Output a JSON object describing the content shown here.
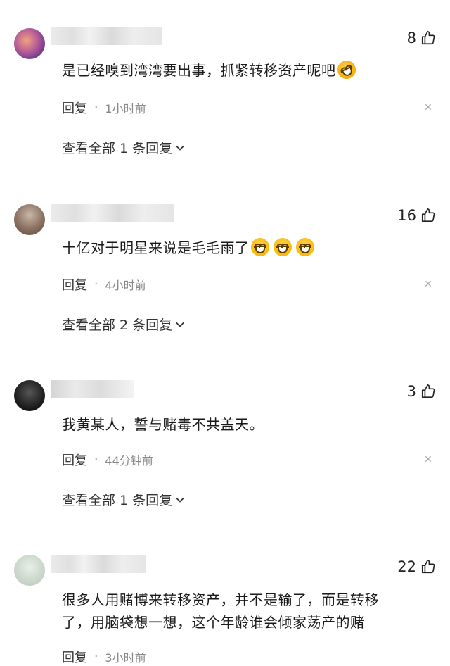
{
  "icons": {
    "like": "thumbs-up-icon",
    "close": "close-icon",
    "expand": "chevron-down-icon"
  },
  "comments": [
    {
      "likes": "8",
      "text": "是已经嗅到湾湾要出事，抓紧转移资产呢吧",
      "reply_label": "回复",
      "separator": "·",
      "time": "1小时前",
      "view_replies": "查看全部 1 条回复",
      "emoji": [
        "rofl-emoji"
      ]
    },
    {
      "likes": "16",
      "text": "十亿对于明星来说是毛毛雨了",
      "reply_label": "回复",
      "separator": "·",
      "time": "4小时前",
      "view_replies": "查看全部 2 条回复",
      "emoji": [
        "grin-emoji",
        "grin-emoji",
        "grin-emoji"
      ]
    },
    {
      "likes": "3",
      "text": "我黄某人，誓与赌毒不共盖天。",
      "reply_label": "回复",
      "separator": "·",
      "time": "44分钟前",
      "view_replies": "查看全部 1 条回复"
    },
    {
      "likes": "22",
      "text_line1": "很多人用赌博来转移资产，并不是输了，而是转移",
      "text_line2": "了，用脑袋想一想，这个年龄谁会倾家荡产的赌",
      "reply_label": "回复",
      "separator": "·",
      "time": "3小时前"
    }
  ]
}
